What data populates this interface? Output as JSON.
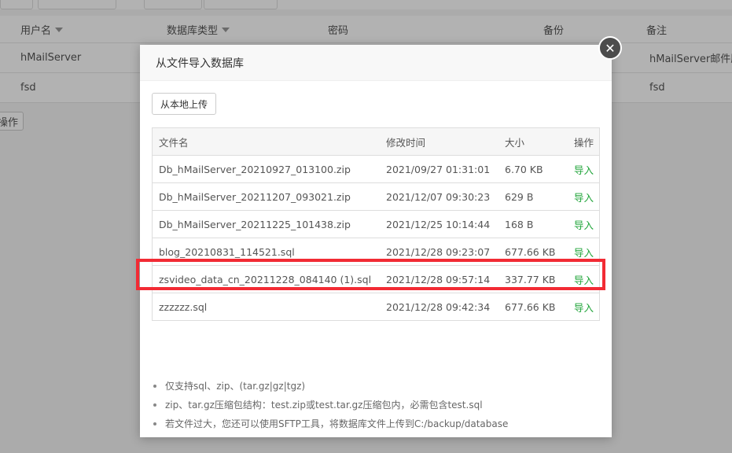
{
  "background": {
    "columns": [
      "用户名",
      "数据库类型",
      "密码",
      "备份",
      "备注"
    ],
    "rows": [
      {
        "username": "hMailServer",
        "note": "hMailServer邮件服"
      },
      {
        "username": "fsd",
        "note": "fsd"
      }
    ],
    "op_button": "操作"
  },
  "modal": {
    "title": "从文件导入数据库",
    "upload_button": "从本地上传",
    "close_icon": "close-icon",
    "columns": {
      "name": "文件名",
      "time": "修改时间",
      "size": "大小",
      "op": "操作"
    },
    "files": [
      {
        "name": "Db_hMailServer_20210927_013100.zip",
        "time": "2021/09/27 01:31:01",
        "size": "6.70 KB",
        "action": "导入"
      },
      {
        "name": "Db_hMailServer_20211207_093021.zip",
        "time": "2021/12/07 09:30:23",
        "size": "629 B",
        "action": "导入"
      },
      {
        "name": "Db_hMailServer_20211225_101438.zip",
        "time": "2021/12/25 10:14:44",
        "size": "168 B",
        "action": "导入"
      },
      {
        "name": "blog_20210831_114521.sql",
        "time": "2021/12/28 09:23:07",
        "size": "677.66 KB",
        "action": "导入"
      },
      {
        "name": "zsvideo_data_cn_20211228_084140 (1).sql",
        "time": "2021/12/28 09:57:14",
        "size": "337.77 KB",
        "action": "导入"
      },
      {
        "name": "zzzzzz.sql",
        "time": "2021/12/28 09:42:34",
        "size": "677.66 KB",
        "action": "导入"
      }
    ],
    "tips": [
      "仅支持sql、zip、(tar.gz|gz|tgz)",
      "zip、tar.gz压缩包结构：test.zip或test.tar.gz压缩包内，必需包含test.sql",
      "若文件过大，您还可以使用SFTP工具，将数据库文件上传到C:/backup/database"
    ]
  },
  "colors": {
    "accent": "#20a53a",
    "highlight": "#f22b34"
  }
}
